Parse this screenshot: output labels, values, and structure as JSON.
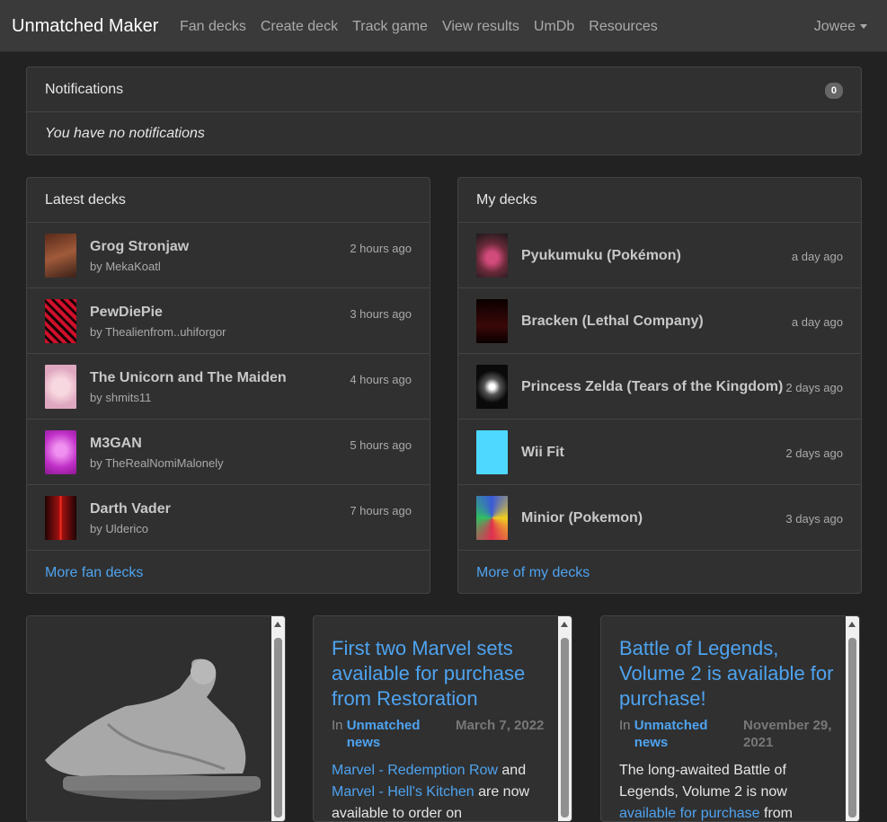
{
  "nav": {
    "brand": "Unmatched Maker",
    "links": [
      "Fan decks",
      "Create deck",
      "Track game",
      "View results",
      "UmDb",
      "Resources"
    ],
    "user": "Jowee"
  },
  "notifications": {
    "title": "Notifications",
    "count": "0",
    "empty_text": "You have no notifications"
  },
  "latest_decks": {
    "title": "Latest decks",
    "items": [
      {
        "name": "Grog Stronjaw",
        "author": "by MekaKoatl",
        "time": "2 hours ago",
        "color": "#7a3a2a"
      },
      {
        "name": "PewDiePie",
        "author": "by Thealienfrom..uhiforgor",
        "time": "3 hours ago",
        "color": "#c0102a"
      },
      {
        "name": "The Unicorn and The Maiden",
        "author": "by shmits11",
        "time": "4 hours ago",
        "color": "#e8b8c8"
      },
      {
        "name": "M3GAN",
        "author": "by TheRealNomiMalonely",
        "time": "5 hours ago",
        "color": "#d050d8"
      },
      {
        "name": "Darth Vader",
        "author": "by Ulderico",
        "time": "7 hours ago",
        "color": "#8a1010"
      }
    ],
    "more": "More fan decks"
  },
  "my_decks": {
    "title": "My decks",
    "items": [
      {
        "name": "Pyukumuku (Pokémon)",
        "time": "a day ago",
        "color": "#b03a6a"
      },
      {
        "name": "Bracken (Lethal Company)",
        "time": "a day ago",
        "color": "#2a0a0a"
      },
      {
        "name": "Princess Zelda (Tears of the Kingdom)",
        "time": "2 days ago",
        "color": "#1a1a1a"
      },
      {
        "name": "Wii Fit",
        "time": "2 days ago",
        "color": "#4fd8ff"
      },
      {
        "name": "Minior (Pokemon)",
        "time": "3 days ago",
        "color": "#3a5ad8"
      }
    ],
    "more": "More of my decks"
  },
  "news": [
    {
      "title": "First two Marvel sets available for purchase from Restoration",
      "in": "In",
      "category": "Unmatched news",
      "date": "March 7, 2022",
      "link1": "Marvel - Redemption Row",
      "mid": "and",
      "link2": "Marvel - Hell's Kitchen",
      "rest": "are now available to order on"
    },
    {
      "title": "Battle of Legends, Volume 2 is available for purchase!",
      "in": "In",
      "category": "Unmatched news",
      "date": "November 29, 2021",
      "text": "The long-awaited Battle of Legends, Volume 2 is now",
      "link": "available for purchase",
      "rest": "from"
    }
  ]
}
